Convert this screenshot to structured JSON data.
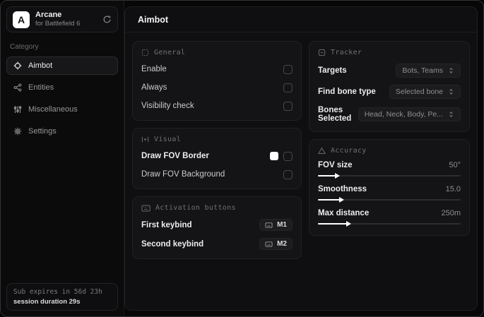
{
  "brand": {
    "logo_letter": "A",
    "name": "Arcane",
    "subtitle": "for Battlefield 6"
  },
  "sidebar": {
    "category_label": "Category",
    "items": [
      {
        "label": "Aimbot",
        "icon": "crosshair-icon",
        "active": true
      },
      {
        "label": "Entities",
        "icon": "entities-icon",
        "active": false
      },
      {
        "label": "Miscellaneous",
        "icon": "sliders-icon",
        "active": false
      },
      {
        "label": "Settings",
        "icon": "gear-icon",
        "active": false
      }
    ],
    "footer": {
      "sub_expires": "Sub expires in 56d 23h",
      "session_duration": "session duration 29s"
    }
  },
  "main": {
    "title": "Aimbot",
    "general": {
      "title": "General",
      "rows": [
        {
          "label": "Enable",
          "checked": false
        },
        {
          "label": "Always",
          "checked": false
        },
        {
          "label": "Visibility check",
          "checked": false
        }
      ]
    },
    "visual": {
      "title": "Visual",
      "rows": [
        {
          "label": "Draw FOV Border",
          "swatch_color": "#ffffff",
          "checked": false
        },
        {
          "label": "Draw FOV Background",
          "checked": false
        }
      ]
    },
    "activation": {
      "title": "Activation buttons",
      "rows": [
        {
          "label": "First keybind",
          "key": "M1"
        },
        {
          "label": "Second keybind",
          "key": "M2"
        }
      ]
    },
    "tracker": {
      "title": "Tracker",
      "rows": [
        {
          "label": "Targets",
          "value": "Bots, Teams"
        },
        {
          "label": "Find bone type",
          "value": "Selected bone"
        },
        {
          "label": "Bones Selected",
          "value": "Head, Neck, Body, Pe..."
        }
      ]
    },
    "accuracy": {
      "title": "Accuracy",
      "rows": [
        {
          "label": "FOV size",
          "value": "50°",
          "percent": 13
        },
        {
          "label": "Smoothness",
          "value": "15.0",
          "percent": 16
        },
        {
          "label": "Max distance",
          "value": "250m",
          "percent": 21
        }
      ]
    }
  },
  "colors": {
    "accent": "#ffffff",
    "swatch": "#ffffff",
    "window_bg": "#070708",
    "panel_bg": "#0f0f11",
    "card_bg": "#141417"
  }
}
